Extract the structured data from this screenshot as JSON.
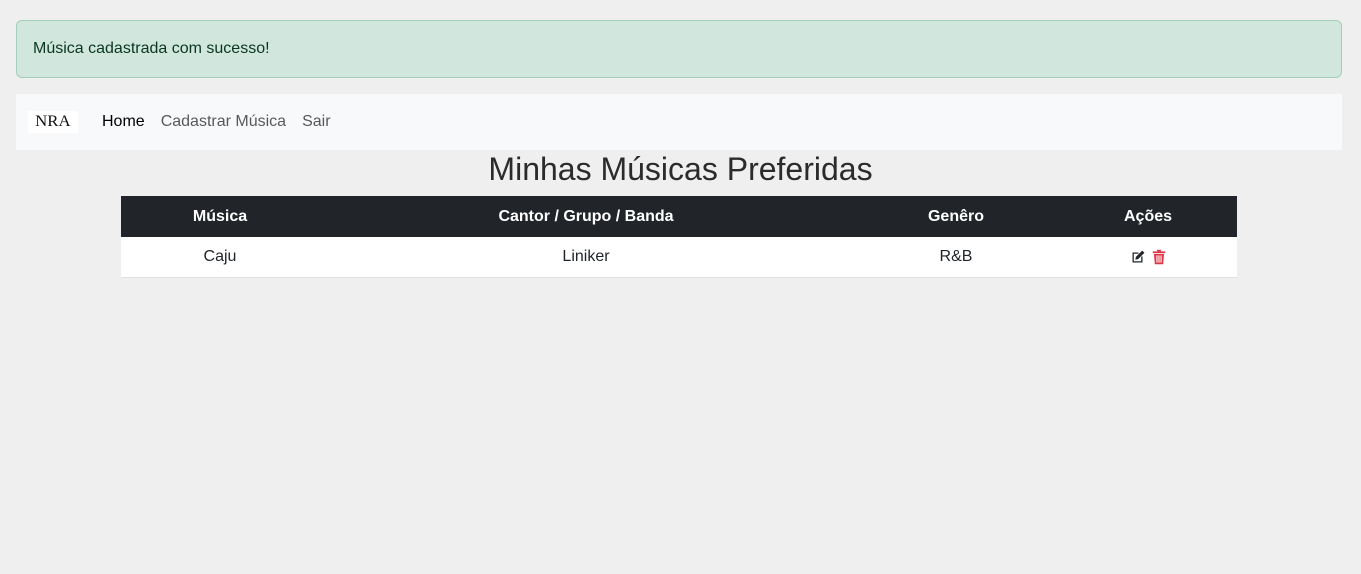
{
  "alert": {
    "message": "Música cadastrada com sucesso!",
    "color": "#d1e7dd"
  },
  "navbar": {
    "brand": "NRA",
    "items": [
      {
        "label": "Home",
        "active": true
      },
      {
        "label": "Cadastrar Música",
        "active": false
      },
      {
        "label": "Sair",
        "active": false
      }
    ]
  },
  "page": {
    "title": "Minhas Músicas Preferidas"
  },
  "table": {
    "headers": [
      "Música",
      "Cantor / Grupo / Banda",
      "Genêro",
      "Ações"
    ],
    "rows": [
      {
        "musica": "Caju",
        "cantor": "Liniker",
        "genero": "R&B",
        "actions": [
          "edit-icon",
          "trash-icon"
        ]
      }
    ]
  },
  "colors": {
    "header_bg": "#212529",
    "delete": "#dc3545"
  }
}
